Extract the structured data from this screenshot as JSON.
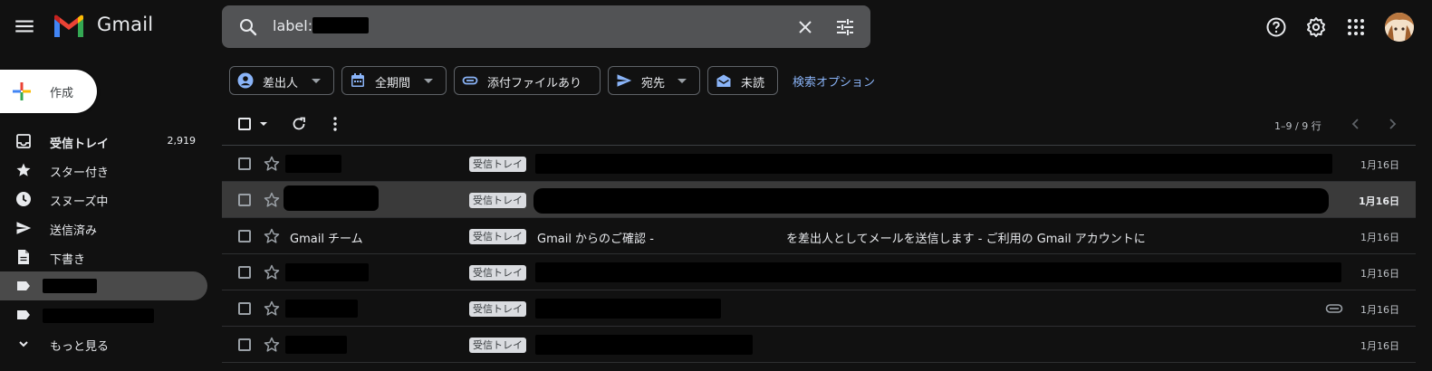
{
  "header": {
    "brand": "Gmail",
    "search_value": "label:",
    "colors": {
      "red": "#ea4335",
      "blue": "#4285f4",
      "yellow": "#fbbc04",
      "green": "#34a853",
      "accent": "#8ab4f8"
    }
  },
  "sidebar": {
    "compose_label": "作成",
    "items": [
      {
        "label": "受信トレイ",
        "count": "2,919",
        "icon": "inbox-icon"
      },
      {
        "label": "スター付き",
        "icon": "star-icon"
      },
      {
        "label": "スヌーズ中",
        "icon": "clock-icon"
      },
      {
        "label": "送信済み",
        "icon": "send-icon"
      },
      {
        "label": "下書き",
        "icon": "file-icon"
      },
      {
        "label": "",
        "icon": "label-icon"
      },
      {
        "label": "",
        "icon": "label-icon"
      },
      {
        "label": "もっと見る",
        "icon": "chevron-down-icon"
      }
    ]
  },
  "filters": {
    "chips": [
      {
        "label": "差出人",
        "icon": "person-icon"
      },
      {
        "label": "全期間",
        "icon": "calendar-icon"
      },
      {
        "label": "添付ファイルあり",
        "icon": "attachment-icon"
      },
      {
        "label": "宛先",
        "icon": "send-icon"
      },
      {
        "label": "未読",
        "icon": "unread-mail-icon"
      }
    ],
    "search_options": "検索オプション"
  },
  "toolbar": {
    "range": "1–9 / 9 行"
  },
  "emails": [
    {
      "sender": "",
      "label": "受信トレイ",
      "subject": "",
      "snippet": "",
      "date": "1月16日",
      "unread": false
    },
    {
      "sender": "",
      "label": "受信トレイ",
      "subject": "",
      "snippet": "",
      "date": "1月16日",
      "unread": true
    },
    {
      "sender": "Gmail チーム",
      "label": "受信トレイ",
      "subject": "Gmail からのご確認 - ",
      "snippet": "を差出人としてメールを送信します - ご利用の Gmail アカウントに",
      "date": "1月16日",
      "unread": false
    },
    {
      "sender": "",
      "label": "受信トレイ",
      "subject": "",
      "snippet": "",
      "date": "1月16日",
      "unread": false
    },
    {
      "sender": "",
      "label": "受信トレイ",
      "subject": "",
      "snippet": "",
      "date": "1月16日",
      "unread": false,
      "attachment": true
    },
    {
      "sender": "",
      "label": "受信トレイ",
      "subject": "",
      "snippet": "",
      "date": "1月16日",
      "unread": false
    }
  ]
}
